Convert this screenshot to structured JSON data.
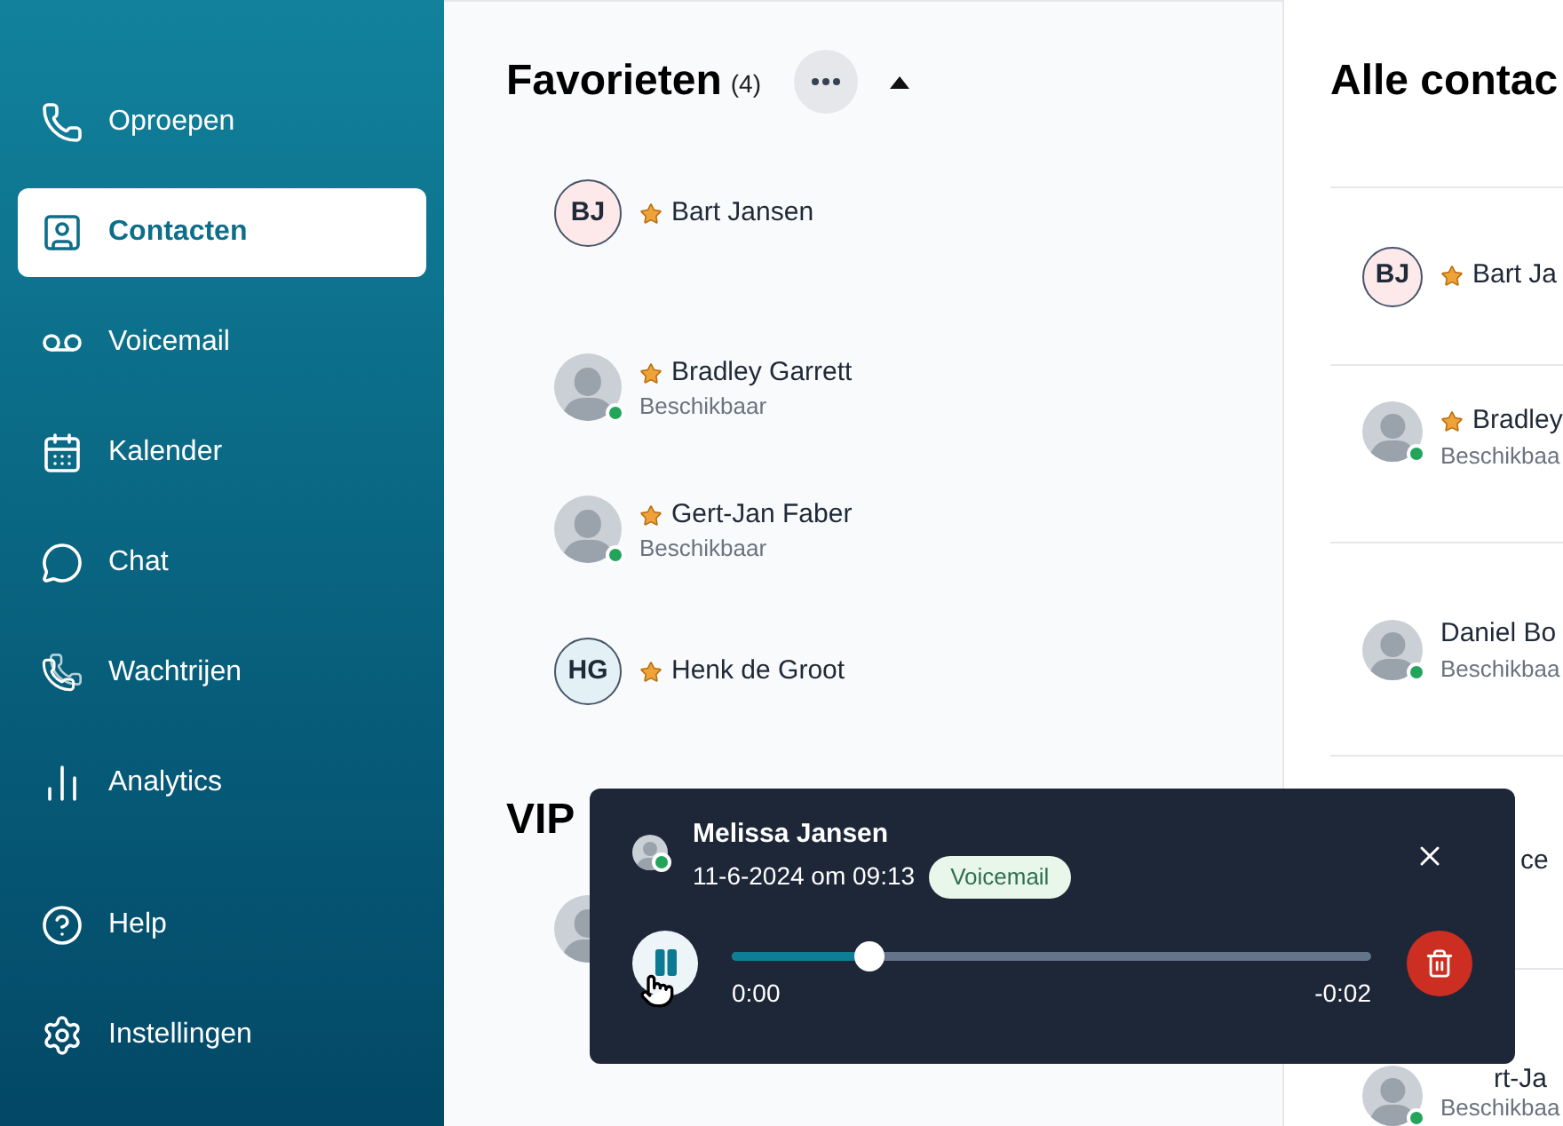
{
  "sidebar": {
    "items": [
      {
        "label": "Oproepen",
        "selected": false
      },
      {
        "label": "Contacten",
        "selected": true
      },
      {
        "label": "Voicemail",
        "selected": false
      },
      {
        "label": "Kalender",
        "selected": false
      },
      {
        "label": "Chat",
        "selected": false
      },
      {
        "label": "Wachtrijen",
        "selected": false
      },
      {
        "label": "Analytics",
        "selected": false
      }
    ],
    "footer_items": [
      {
        "label": "Help",
        "selected": false
      },
      {
        "label": "Instellingen",
        "selected": false
      }
    ]
  },
  "favorites": {
    "title": "Favorieten",
    "count": "(4)",
    "expanded": true,
    "contacts": [
      {
        "avatar": {
          "kind": "initials",
          "initials": "BJ",
          "color": "#fde8ea"
        },
        "name": "Bart Jansen",
        "favorite": true,
        "online": false
      },
      {
        "avatar": {
          "kind": "photo"
        },
        "name": "Bradley Garrett",
        "status": "Beschikbaar",
        "favorite": true,
        "online": true
      },
      {
        "avatar": {
          "kind": "photo"
        },
        "name": "Gert-Jan Faber",
        "status": "Beschikbaar",
        "favorite": true,
        "online": true
      },
      {
        "avatar": {
          "kind": "initials",
          "initials": "HG",
          "color": "#e3f1f6"
        },
        "name": "Henk de Groot",
        "favorite": true,
        "online": false
      }
    ]
  },
  "vips": {
    "title": "VIP"
  },
  "all_contacts": {
    "title": "Alle contac",
    "contacts": [
      {
        "kind": "full",
        "avatar": {
          "kind": "initials",
          "initials": "BJ",
          "color": "#fde8ea"
        },
        "name": "Bart Ja",
        "favorite": true,
        "online": false
      },
      {
        "kind": "full",
        "avatar": {
          "kind": "photo"
        },
        "name": "Bradley",
        "status": "Beschikbaa",
        "favorite": true,
        "online": true
      },
      {
        "kind": "full",
        "avatar": {
          "kind": "photo"
        },
        "name": "Daniel Bo",
        "status": "Beschikbaa",
        "favorite": false,
        "online": true
      },
      {
        "kind": "covered",
        "name": "ce"
      },
      {
        "kind": "partial",
        "avatar": {
          "kind": "photo"
        },
        "name": "rt-Ja",
        "status": "Beschikbaa",
        "online": true
      }
    ]
  },
  "player": {
    "name": "Melissa Jansen",
    "online": true,
    "date": "11-6-2024 om 09:13",
    "badge": "Voicemail",
    "playing": true,
    "level": 0.215,
    "elapsed": "0:00",
    "remaining": "-0:02"
  }
}
